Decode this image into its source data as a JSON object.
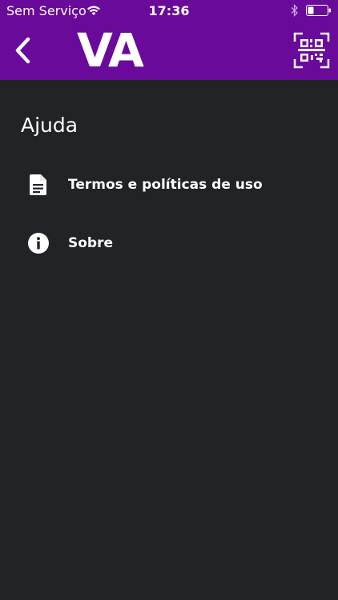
{
  "status_bar": {
    "carrier": "Sem Serviço",
    "time": "17:36"
  },
  "nav": {
    "logo_text": "VA",
    "background_color": "#6a0a9b"
  },
  "page": {
    "title": "Ajuda",
    "background_color": "#212327"
  },
  "menu": {
    "items": [
      {
        "icon": "document-icon",
        "label": "Termos e políticas de uso"
      },
      {
        "icon": "info-icon",
        "label": "Sobre"
      }
    ]
  }
}
